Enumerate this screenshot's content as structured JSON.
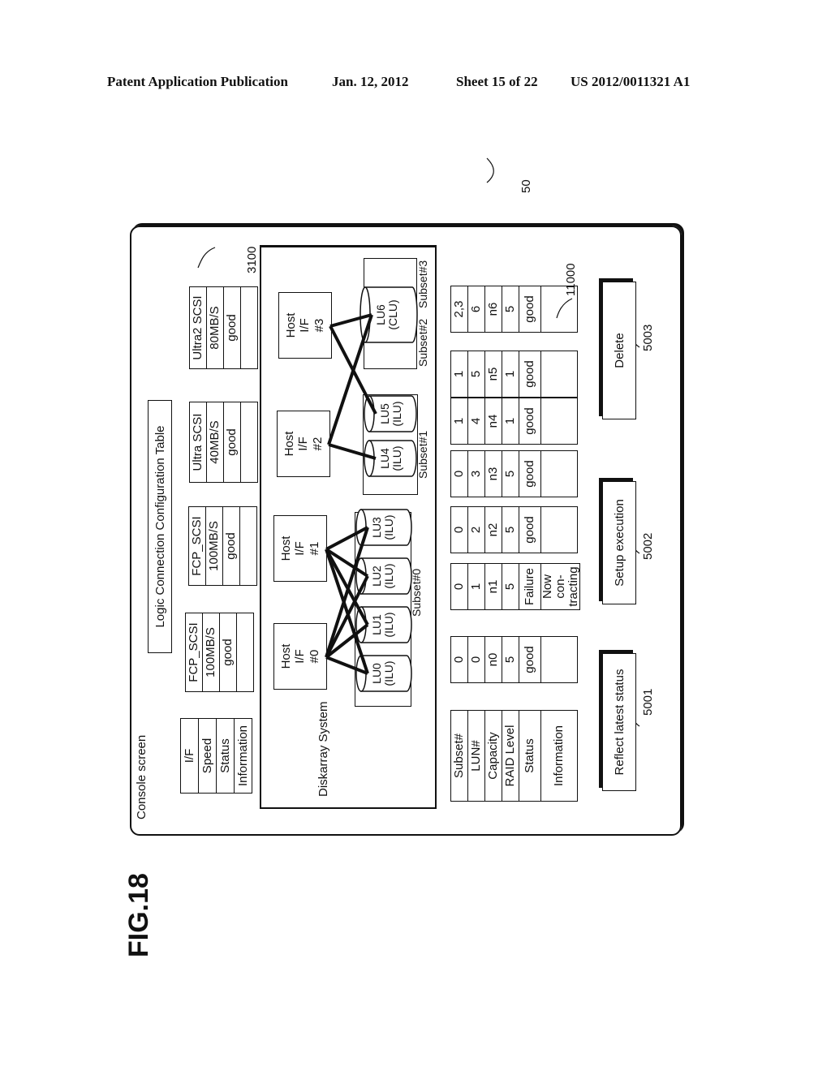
{
  "header": {
    "publication": "Patent Application Publication",
    "date": "Jan. 12, 2012",
    "sheet": "Sheet 15 of 22",
    "number": "US 2012/0011321 A1"
  },
  "figure": {
    "label": "FIG.18",
    "console_title": "Console screen",
    "console_ref": "50",
    "config_table_button": "Logic Connection Configuration Table",
    "if_table": {
      "ref": "3100",
      "row_labels": [
        "I/F",
        "Speed",
        "Status",
        "Information"
      ],
      "columns": [
        {
          "if": "FCP_SCSI",
          "speed": "100MB/S",
          "status": "good",
          "information": ""
        },
        {
          "if": "FCP_SCSI",
          "speed": "100MB/S",
          "status": "good",
          "information": ""
        },
        {
          "if": "Ultra SCSI",
          "speed": "40MB/S",
          "status": "good",
          "information": ""
        },
        {
          "if": "Ultra2 SCSI",
          "speed": "80MB/S",
          "status": "good",
          "information": ""
        }
      ]
    },
    "diskarray": {
      "label": "Diskarray System",
      "hosts": [
        {
          "l1": "Host",
          "l2": "I/F",
          "l3": "#0"
        },
        {
          "l1": "Host",
          "l2": "I/F",
          "l3": "#1"
        },
        {
          "l1": "Host",
          "l2": "I/F",
          "l3": "#2"
        },
        {
          "l1": "Host",
          "l2": "I/F",
          "l3": "#3"
        }
      ],
      "subsets": [
        "Subset#0",
        "Subset#1",
        "Subset#2",
        "Subset#3"
      ],
      "lus": [
        {
          "name": "LU0",
          "type": "(ILU)"
        },
        {
          "name": "LU1",
          "type": "(ILU)"
        },
        {
          "name": "LU2",
          "type": "(ILU)"
        },
        {
          "name": "LU3",
          "type": "(ILU)"
        },
        {
          "name": "LU4",
          "type": "(ILU)"
        },
        {
          "name": "LU5",
          "type": "(ILU)"
        },
        {
          "name": "LU6",
          "type": "(CLU)"
        }
      ],
      "connections": [
        [
          "#0",
          "LU0"
        ],
        [
          "#0",
          "LU1"
        ],
        [
          "#0",
          "LU2"
        ],
        [
          "#0",
          "LU3"
        ],
        [
          "#1",
          "LU0"
        ],
        [
          "#1",
          "LU1"
        ],
        [
          "#1",
          "LU2"
        ],
        [
          "#1",
          "LU3"
        ],
        [
          "#2",
          "LU4"
        ],
        [
          "#2",
          "LU6"
        ],
        [
          "#3",
          "LU5"
        ],
        [
          "#3",
          "LU6"
        ]
      ]
    },
    "lu_table": {
      "ref": "11000",
      "row_labels": [
        "Subset#",
        "LUN#",
        "Capacity",
        "RAID Level",
        "Status",
        "Information"
      ],
      "columns": [
        {
          "subset": "0",
          "lun": "0",
          "capacity": "n0",
          "raid": "5",
          "status": "good",
          "information": ""
        },
        {
          "subset": "0",
          "lun": "1",
          "capacity": "n1",
          "raid": "5",
          "status": "Failure",
          "information": "Now con- tracting"
        },
        {
          "subset": "0",
          "lun": "2",
          "capacity": "n2",
          "raid": "5",
          "status": "good",
          "information": ""
        },
        {
          "subset": "0",
          "lun": "3",
          "capacity": "n3",
          "raid": "5",
          "status": "good",
          "information": ""
        },
        {
          "subset": "1",
          "lun": "4",
          "capacity": "n4",
          "raid": "1",
          "status": "good",
          "information": ""
        },
        {
          "subset": "1",
          "lun": "5",
          "capacity": "n5",
          "raid": "1",
          "status": "good",
          "information": ""
        },
        {
          "subset": "2,3",
          "lun": "6",
          "capacity": "n6",
          "raid": "5",
          "status": "good",
          "information": ""
        }
      ]
    },
    "buttons": [
      {
        "label": "Reflect latest status",
        "ref": "5001"
      },
      {
        "label": "Setup execution",
        "ref": "5002"
      },
      {
        "label": "Delete",
        "ref": "5003"
      }
    ]
  }
}
